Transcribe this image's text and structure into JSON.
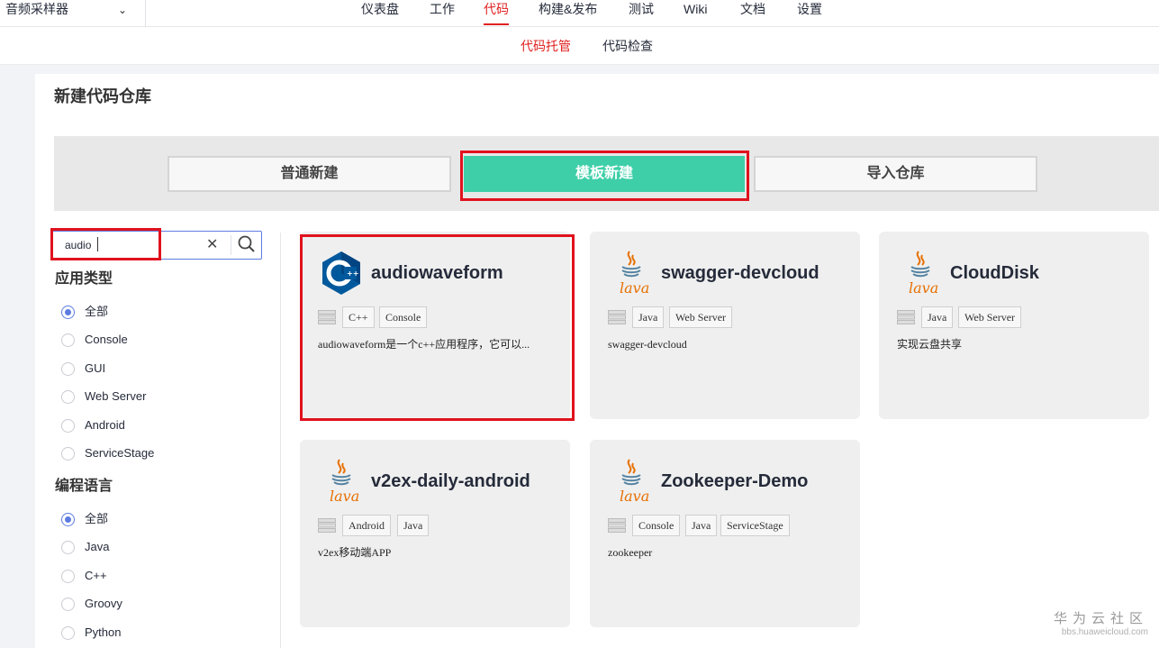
{
  "project": {
    "name": "音频采样器"
  },
  "nav": [
    "仪表盘",
    "工作",
    "代码",
    "构建&发布",
    "测试",
    "Wiki",
    "文档",
    "设置"
  ],
  "nav_active": "代码",
  "subnav": [
    "代码托管",
    "代码检查"
  ],
  "page": {
    "title": "新建代码仓库"
  },
  "modes": [
    "普通新建",
    "模板新建",
    "导入仓库"
  ],
  "search": {
    "value": "audio"
  },
  "filters": {
    "app_type": {
      "title": "应用类型",
      "options": [
        "全部",
        "Console",
        "GUI",
        "Web Server",
        "Android",
        "ServiceStage"
      ],
      "selected": "全部"
    },
    "language": {
      "title": "编程语言",
      "options": [
        "全部",
        "Java",
        "C++",
        "Groovy",
        "Python"
      ],
      "selected": "全部"
    }
  },
  "templates": [
    {
      "name": "audiowaveform",
      "logo": "cpp-icon",
      "tags": [
        "C++",
        "Console"
      ],
      "desc": "audiowaveform是一个c++应用程序，它可以..."
    },
    {
      "name": "swagger-devcloud",
      "logo": "java-icon",
      "tags": [
        "Java",
        "Web Server"
      ],
      "desc": "swagger-devcloud"
    },
    {
      "name": "CloudDisk",
      "logo": "java-icon",
      "tags": [
        "Java",
        "Web Server"
      ],
      "desc": "实现云盘共享"
    },
    {
      "name": "v2ex-daily-android",
      "logo": "java-icon",
      "tags": [
        "Android",
        "Java"
      ],
      "desc": "v2ex移动端APP"
    },
    {
      "name": "Zookeeper-Demo",
      "logo": "java-icon",
      "tags": [
        "Console",
        "Java",
        "ServiceStage"
      ],
      "desc": "zookeeper"
    }
  ],
  "watermark": {
    "cn": "华为云社区",
    "en": "bbs.huaweicloud.com"
  },
  "colors": {
    "accent_red": "#e02020",
    "selected_mode": "#3ecfa8",
    "highlight_box": "#e0121e",
    "radio": "#5e7ce0"
  }
}
